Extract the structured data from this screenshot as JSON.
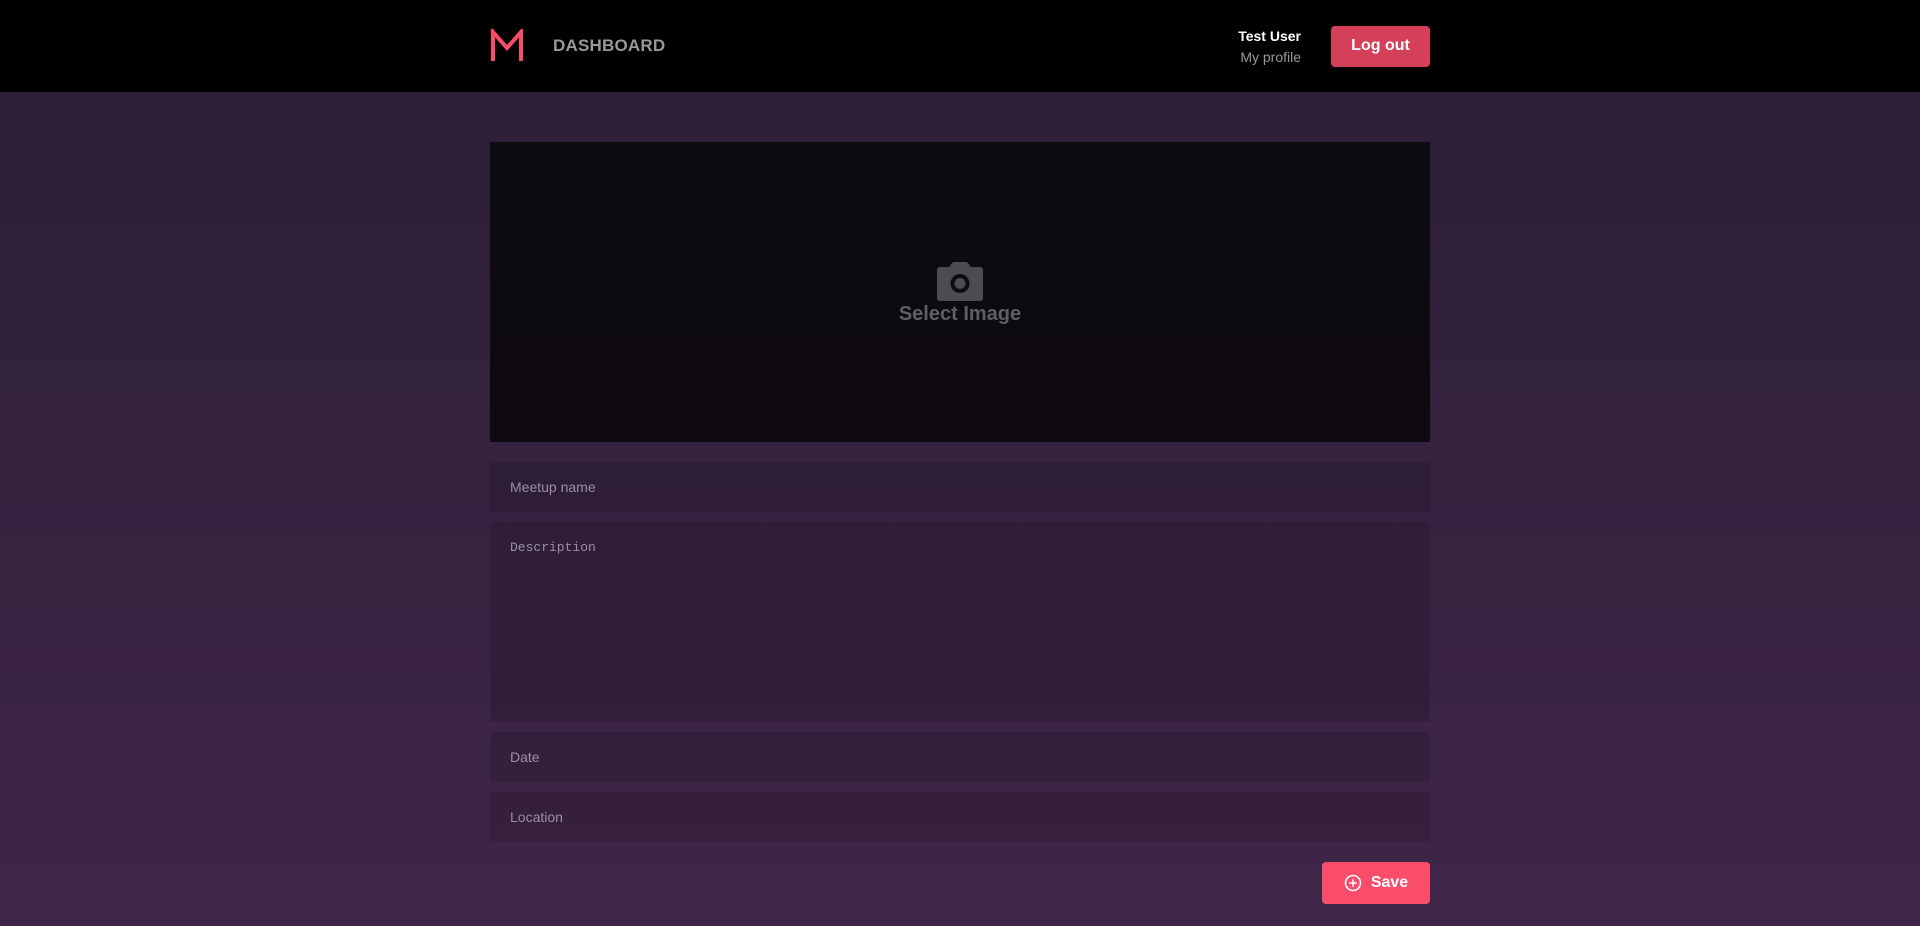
{
  "header": {
    "nav_title": "DASHBOARD",
    "user_name": "Test User",
    "profile_link": "My profile",
    "logout_label": "Log out"
  },
  "image_picker": {
    "icon": "camera-icon",
    "label": "Select Image"
  },
  "form": {
    "name_placeholder": "Meetup name",
    "description_placeholder": "Description",
    "date_placeholder": "Date",
    "location_placeholder": "Location",
    "save_label": "Save",
    "save_icon": "plus-circle-icon"
  },
  "colors": {
    "accent": "#f94d6a",
    "header_bg": "#000000",
    "logout_bg": "#d44059"
  }
}
